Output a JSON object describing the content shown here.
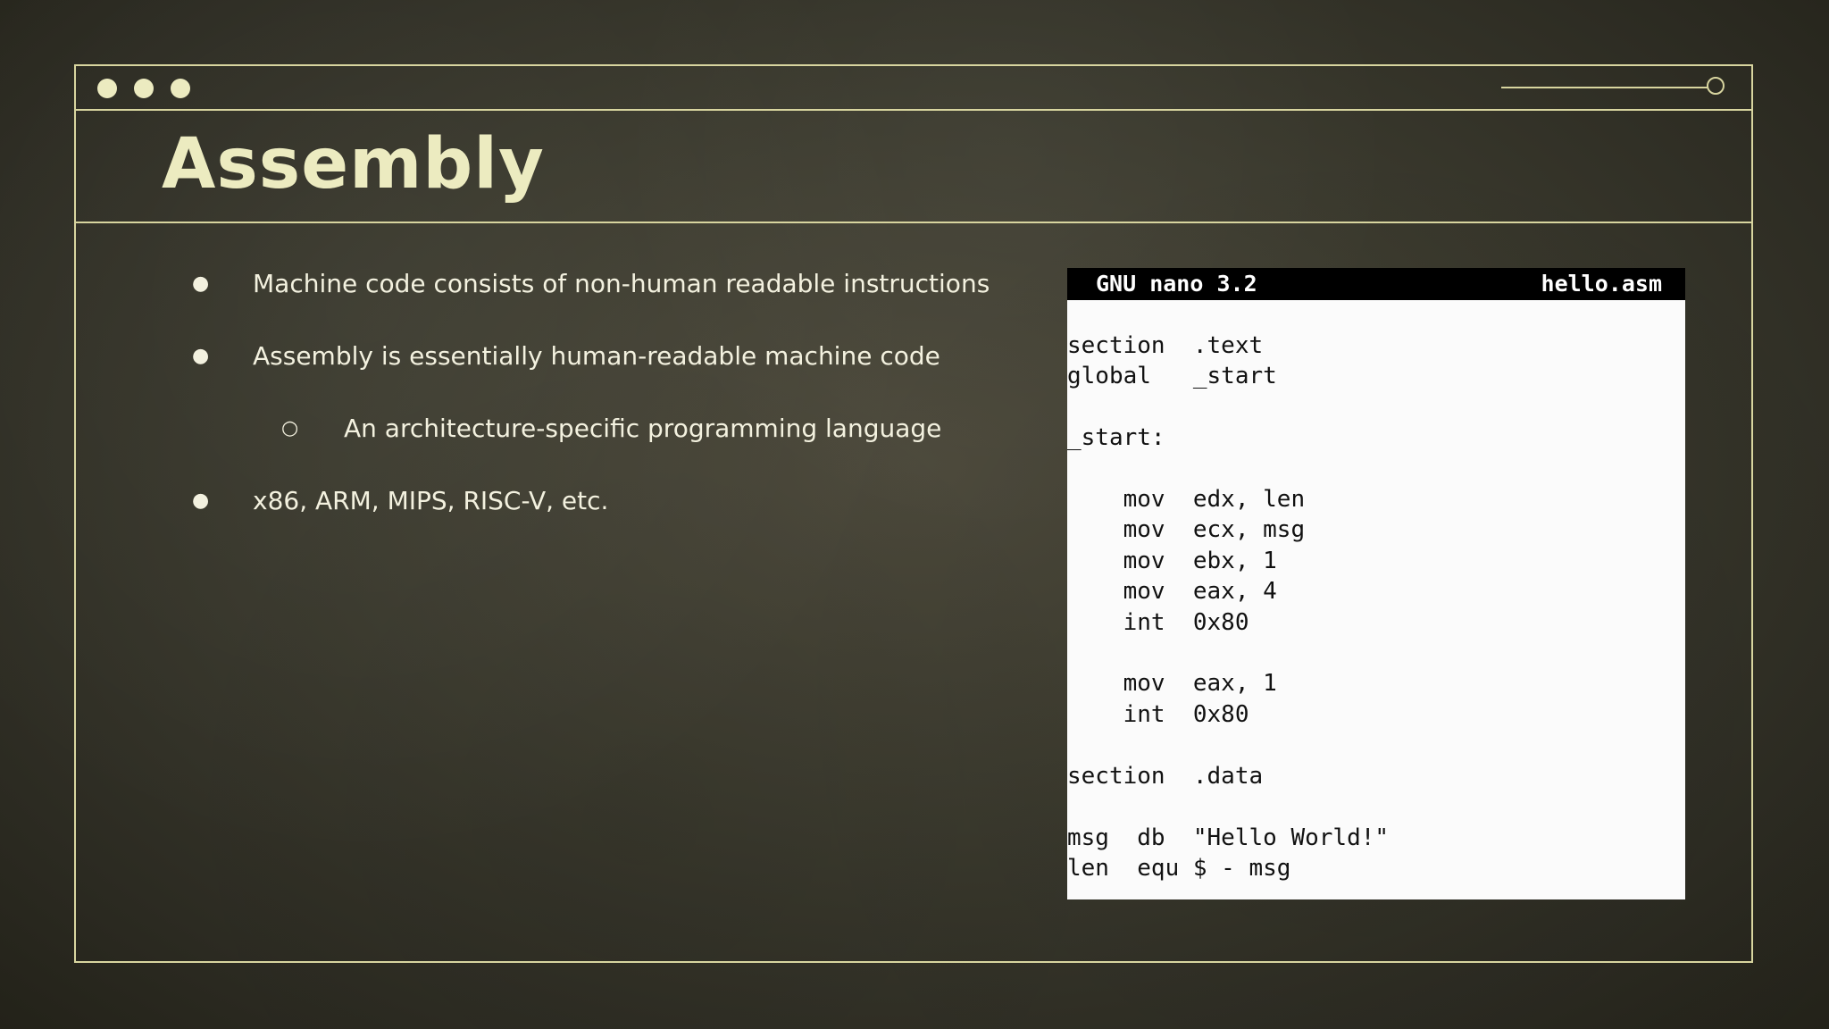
{
  "slide": {
    "title": "Assembly"
  },
  "bullets": [
    "Machine code consists of non-human readable instructions",
    "Assembly is essentially human-readable machine code",
    "An architecture-specific programming language",
    "x86, ARM, MIPS, RISC-V, etc."
  ],
  "bullet_marks": {
    "filled": "●",
    "hollow": "○"
  },
  "editor": {
    "app": "GNU nano 3.2",
    "filename": "hello.asm",
    "code": "section  .text\nglobal   _start\n\n_start:\n\n    mov  edx, len\n    mov  ecx, msg\n    mov  ebx, 1\n    mov  eax, 4\n    int  0x80\n\n    mov  eax, 1\n    int  0x80\n\nsection  .data\n\nmsg  db  \"Hello World!\"\nlen  equ $ - msg"
  },
  "colors": {
    "accent": "#ecebc0",
    "frame": "#d8d59f",
    "background": "#3b3a2e"
  }
}
